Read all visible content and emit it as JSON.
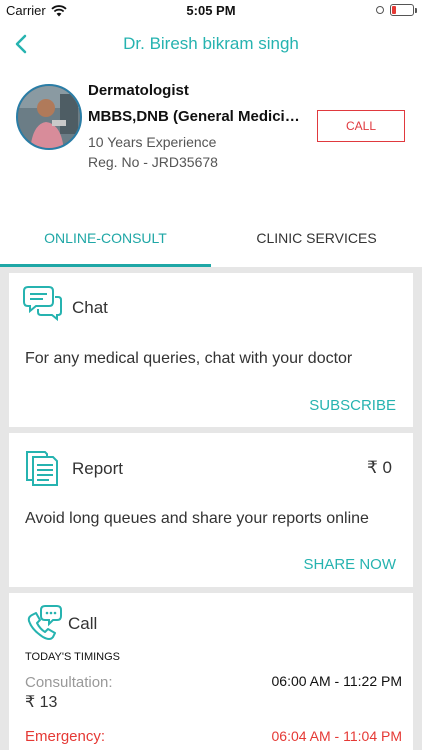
{
  "status_bar": {
    "carrier": "Carrier",
    "time": "5:05 PM"
  },
  "nav": {
    "title": "Dr. Biresh bikram singh"
  },
  "doctor": {
    "specialty": "Dermatologist",
    "degree": "MBBS,DNB (General Medicine)",
    "experience": "10 Years Experience",
    "registration": "Reg. No - JRD35678",
    "call_label": "CALL"
  },
  "tabs": [
    {
      "label": "ONLINE-CONSULT",
      "active": true
    },
    {
      "label": "CLINIC SERVICES",
      "active": false
    }
  ],
  "cards": {
    "chat": {
      "icon": "chat-bubbles-icon",
      "title": "Chat",
      "description": "For any medical queries, chat with your doctor",
      "action": "SUBSCRIBE"
    },
    "report": {
      "icon": "report-documents-icon",
      "title": "Report",
      "price": "₹ 0",
      "description": "Avoid long queues and share your reports online",
      "action": "SHARE NOW"
    },
    "call": {
      "icon": "phone-chat-icon",
      "title": "Call",
      "timings_label": "TODAY'S TIMINGS",
      "consultation_label": "Consultation:",
      "consultation_time": "06:00 AM - 11:22 PM",
      "consultation_price": "₹ 13",
      "emergency_label": "Emergency:",
      "emergency_time": "06:04 AM - 11:04 PM"
    }
  },
  "colors": {
    "accent": "#26b3b0",
    "call_red": "#e0393e",
    "background": "#e6e6e6"
  }
}
